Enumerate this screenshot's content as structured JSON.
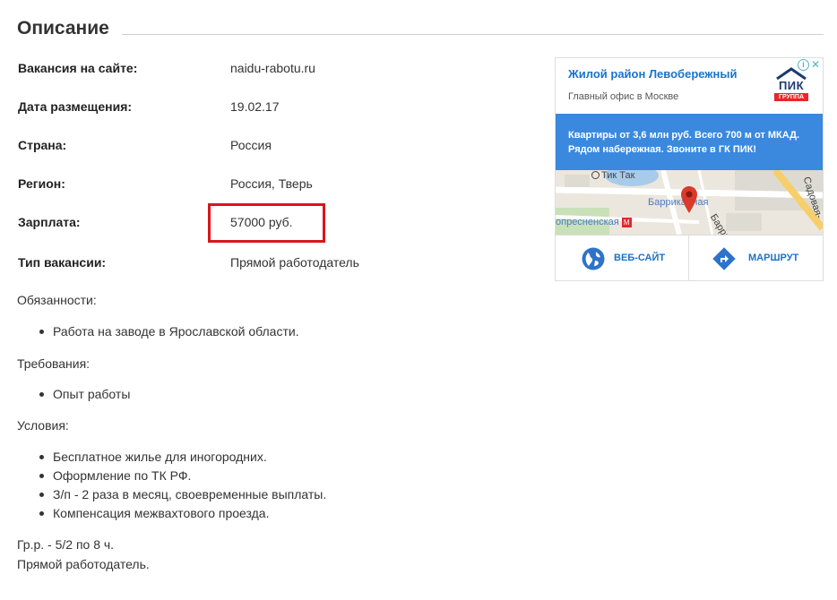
{
  "section": {
    "title": "Описание"
  },
  "fields": [
    {
      "label": "Вакансия на сайте:",
      "value": "naidu-rabotu.ru"
    },
    {
      "label": "Дата размещения:",
      "value": "19.02.17"
    },
    {
      "label": "Страна:",
      "value": "Россия"
    },
    {
      "label": "Регион:",
      "value": "Россия, Тверь"
    },
    {
      "label": "Зарплата:",
      "value": "57000 руб."
    },
    {
      "label": "Тип вакансии:",
      "value": "Прямой работодатель"
    }
  ],
  "description": {
    "duties_heading": "Обязанности:",
    "duties": [
      "Работа на заводе в Ярославской области."
    ],
    "requirements_heading": "Требования:",
    "requirements": [
      "Опыт работы"
    ],
    "conditions_heading": "Условия:",
    "conditions": [
      "Бесплатное жилье для иногородних.",
      "Оформление по ТК РФ.",
      "З/п - 2 раза в месяц, своевременные выплаты.",
      "Компенсация межвахтового проезда."
    ],
    "schedule": "Гр.р. - 5/2 по 8 ч.",
    "employer_note": "Прямой работодатель."
  },
  "ad": {
    "title": "Жилой район Левобережный",
    "subtitle": "Главный офис в Москве",
    "logo_text": "ПИК",
    "logo_badge": "ГРУППА",
    "banner_text": "Квартиры от 3,6 млн руб. Всего 700 м от МКАД. Рядом набережная. Звоните в ГК ПИК!",
    "map_labels": {
      "tik_tak": "Тик Так",
      "barrikadnaya": "Баррикадная",
      "presnenskaya": "опресненская",
      "barri_street": "Барри",
      "sadovaya": "Садовая-"
    },
    "website_label": "ВЕБ-САЙТ",
    "route_label": "МАРШРУТ",
    "colors": {
      "accent": "#1a73c8",
      "banner": "#3a89df",
      "highlight": "#d9151c",
      "metro": "#e8262b"
    }
  }
}
